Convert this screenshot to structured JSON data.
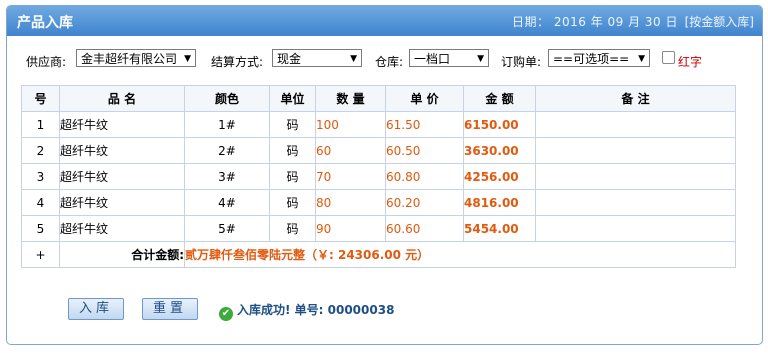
{
  "window": {
    "title": "产品入库",
    "date_text": "日期： 2016 年 09 月 30 日",
    "mode_link": "[按金额入库]"
  },
  "filters": {
    "supplier_label": "供应商:",
    "supplier_value": "金丰超纤有限公司",
    "payment_label": "结算方式:",
    "payment_value": "现金",
    "warehouse_label": "仓库:",
    "warehouse_value": "一档口",
    "order_label": "订购单:",
    "order_value": "==可选项==",
    "red_label": "红字"
  },
  "table": {
    "headers": [
      "号",
      "品 名",
      "颜色",
      "单位",
      "数 量",
      "单 价",
      "金 额",
      "备 注"
    ],
    "rows": [
      {
        "no": "1",
        "name": "超纤牛纹",
        "color": "1#",
        "unit": "码",
        "qty": "100",
        "price": "61.50",
        "amount": "6150.00",
        "note": ""
      },
      {
        "no": "2",
        "name": "超纤牛纹",
        "color": "2#",
        "unit": "码",
        "qty": "60",
        "price": "60.50",
        "amount": "3630.00",
        "note": ""
      },
      {
        "no": "3",
        "name": "超纤牛纹",
        "color": "3#",
        "unit": "码",
        "qty": "70",
        "price": "60.80",
        "amount": "4256.00",
        "note": ""
      },
      {
        "no": "4",
        "name": "超纤牛纹",
        "color": "4#",
        "unit": "码",
        "qty": "80",
        "price": "60.20",
        "amount": "4816.00",
        "note": ""
      },
      {
        "no": "5",
        "name": "超纤牛纹",
        "color": "5#",
        "unit": "码",
        "qty": "90",
        "price": "60.60",
        "amount": "5454.00",
        "note": ""
      }
    ],
    "add_row": "+",
    "total_label": "合计金额:",
    "total_value": "贰万肆仟叁佰零陆元整（￥: 24306.00 元）"
  },
  "actions": {
    "submit_label": "入库",
    "reset_label": "重置",
    "success_text": "入库成功! 单号: 00000038"
  },
  "colors": {
    "accent": "#3f84cf",
    "amount": "#e05a10",
    "red_flag": "#cc0000",
    "success_icon": "#3cab3c"
  }
}
